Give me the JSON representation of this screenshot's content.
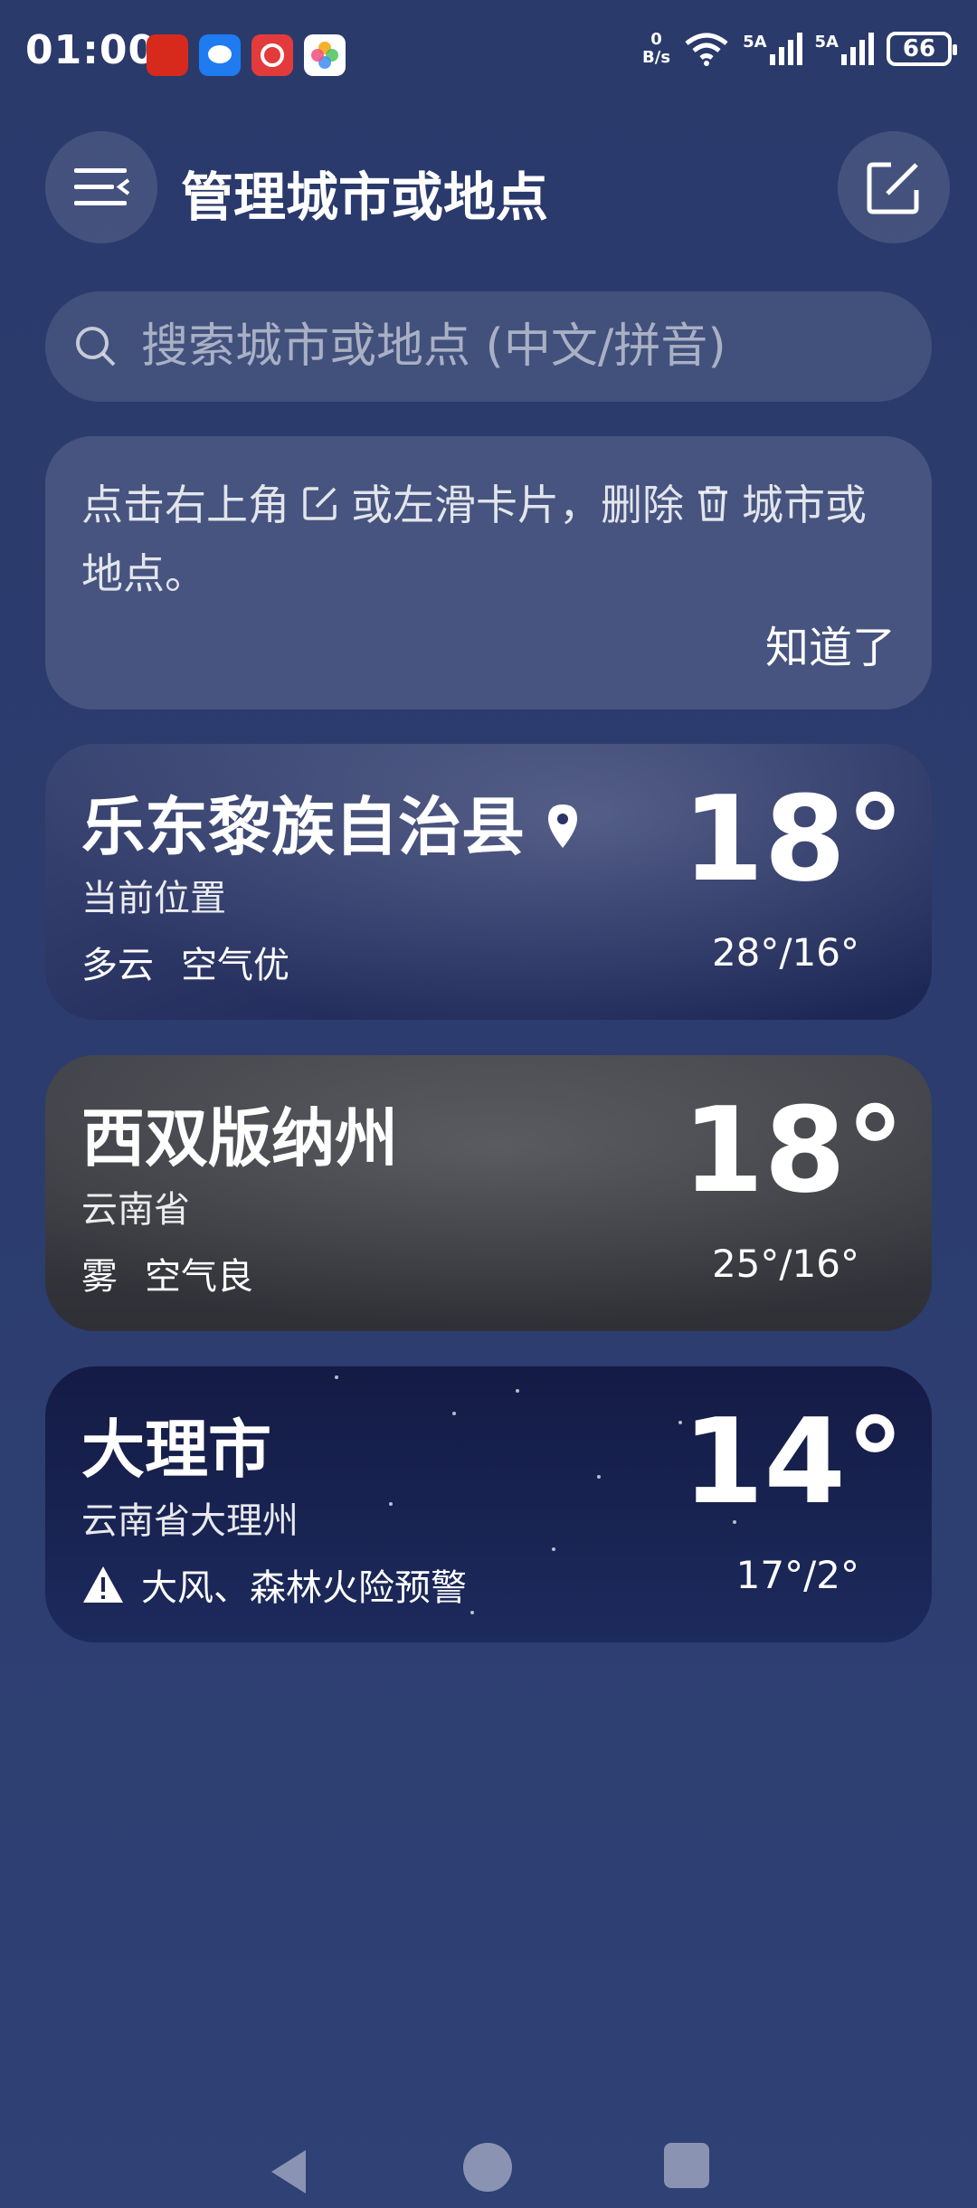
{
  "status_bar": {
    "time": "01:00",
    "net_speed_value": "0",
    "net_speed_unit": "B/s",
    "signal1": "5A",
    "signal2": "5A",
    "battery": "66",
    "app_icons": [
      "red-app-icon",
      "message-app-icon",
      "music-app-icon",
      "photos-app-icon"
    ]
  },
  "header": {
    "title": "管理城市或地点"
  },
  "search": {
    "placeholder": "搜索城市或地点 (中文/拼音)"
  },
  "tip": {
    "text_part1": "点击右上角",
    "text_part2": "或左滑卡片，删除",
    "text_part3": "城市或地点。",
    "dismiss": "知道了"
  },
  "cities": [
    {
      "name": "乐东黎族自治县",
      "sub": "当前位置",
      "condition": "多云",
      "air": "空气优",
      "temp": "18°",
      "range": "28°/16°"
    },
    {
      "name": "西双版纳州",
      "sub": "云南省",
      "condition": "雾",
      "air": "空气良",
      "temp": "18°",
      "range": "25°/16°"
    },
    {
      "name": "大理市",
      "sub": "云南省大理州",
      "warning": "大风、森林火险预警",
      "temp": "14°",
      "range": "17°/2°"
    }
  ],
  "colors": {
    "background": "#2b3b6d",
    "accent": "#ffffff"
  }
}
